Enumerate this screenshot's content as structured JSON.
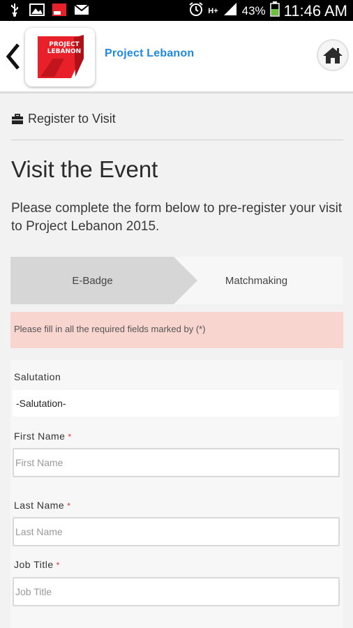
{
  "status_bar": {
    "icons_left": [
      "usb-icon",
      "gallery-icon",
      "app-notification-icon",
      "gmail-icon"
    ],
    "icons_right": [
      "alarm-icon",
      "hplus-data-icon",
      "signal-icon",
      "battery-icon"
    ],
    "data_type": "H+",
    "battery_percent": "43%",
    "time": "11:46 AM"
  },
  "app_bar": {
    "logo_text_line1": "PROJECT",
    "logo_text_line2": "LEBANON",
    "title": "Project Lebanon"
  },
  "breadcrumb": {
    "label": "Register to Visit"
  },
  "page": {
    "title": "Visit the Event",
    "intro": "Please complete the form below to pre-register your visit to Project Lebanon 2015."
  },
  "steps": [
    {
      "label": "E-Badge",
      "active": true
    },
    {
      "label": "Matchmaking",
      "active": false
    }
  ],
  "alert": {
    "message": "Please fill in all the required fields marked by (*)"
  },
  "form": {
    "salutation": {
      "label": "Salutation",
      "value": "-Salutation-"
    },
    "first_name": {
      "label": "First Name",
      "required_mark": "*",
      "placeholder": "First Name"
    },
    "last_name": {
      "label": "Last Name",
      "required_mark": "*",
      "placeholder": "Last Name"
    },
    "job_title": {
      "label": "Job Title",
      "required_mark": "*",
      "placeholder": "Job Title"
    }
  },
  "colors": {
    "accent": "#1e88e5",
    "brand_red": "#e8202a",
    "alert_bg": "#f9d5d0",
    "required": "#dd3333"
  }
}
